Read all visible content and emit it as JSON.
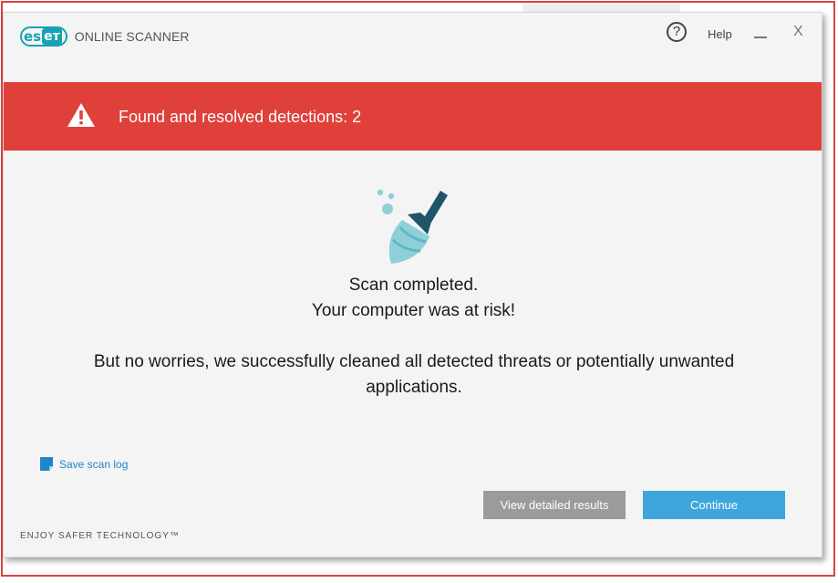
{
  "app": {
    "logo_mark": "eset",
    "logo_product": "ONLINE SCANNER",
    "help_label": "Help",
    "close_glyph": "X"
  },
  "banner": {
    "text": "Found and resolved detections: 2",
    "color": "#e0403a",
    "icon": "warning-icon"
  },
  "main": {
    "icon": "broom-icon",
    "line1": "Scan completed.",
    "line2": "Your computer was at risk!",
    "line3": "But no worries, we successfully cleaned all detected threats or potentially unwanted applications."
  },
  "links": {
    "save_log": "Save scan log"
  },
  "buttons": {
    "details": "View detailed results",
    "continue": "Continue"
  },
  "footer": {
    "tagline": "ENJOY SAFER TECHNOLOGY™"
  },
  "colors": {
    "accent": "#3ea6dc",
    "brand": "#16a2b4",
    "danger": "#e0403a",
    "link": "#1f86c8"
  }
}
